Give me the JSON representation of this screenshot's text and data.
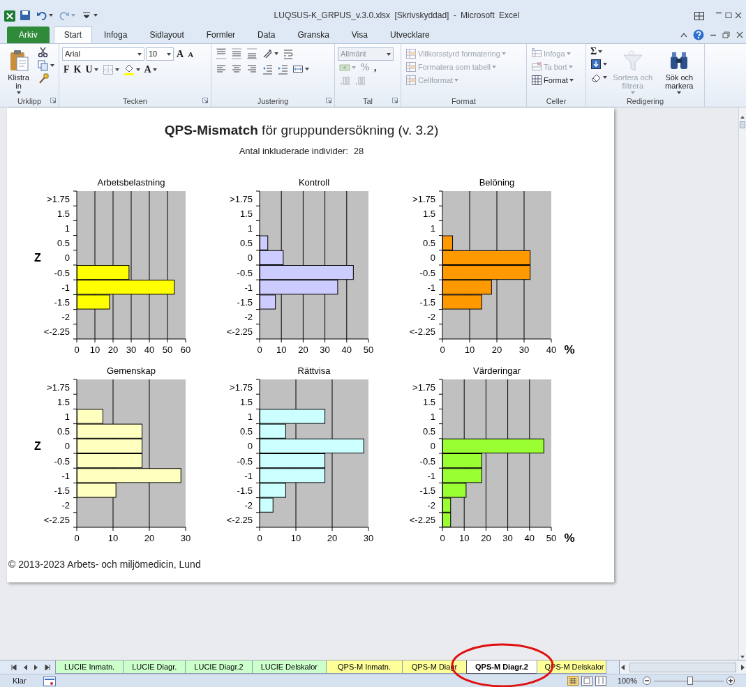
{
  "window": {
    "title": "LUQSUS-K_GRPUS_v.3.0.xlsx [Skrivskyddad] - Microsoft Excel"
  },
  "quick_access": [
    {
      "caret": false,
      "disabled": false
    },
    {
      "caret": true,
      "disabled": false
    },
    {
      "caret": true,
      "disabled": true
    },
    {
      "caret": true,
      "disabled": false
    }
  ],
  "ribbon_tabs": [
    {
      "label": "Arkiv",
      "kind": "file",
      "selected": false
    },
    {
      "label": "Start",
      "kind": "tab",
      "selected": true
    },
    {
      "label": "Infoga",
      "kind": "tab",
      "selected": false
    },
    {
      "label": "Sidlayout",
      "kind": "tab",
      "selected": false
    },
    {
      "label": "Formler",
      "kind": "tab",
      "selected": false
    },
    {
      "label": "Data",
      "kind": "tab",
      "selected": false
    },
    {
      "label": "Granska",
      "kind": "tab",
      "selected": false
    },
    {
      "label": "Visa",
      "kind": "tab",
      "selected": false
    },
    {
      "label": "Utvecklare",
      "kind": "tab",
      "selected": false
    }
  ],
  "ribbon_groups": [
    {
      "label": "Urklipp",
      "launcher": true,
      "columns": [
        [
          {
            "kind": "large",
            "label": "Klistra in",
            "caret": true,
            "disabled": false
          }
        ],
        [
          {
            "kind": "tool",
            "caret": false,
            "disabled": false
          },
          {
            "kind": "tool",
            "caret": true,
            "disabled": false
          },
          {
            "kind": "tool",
            "caret": false,
            "disabled": false
          }
        ]
      ]
    },
    {
      "label": "Tecken",
      "launcher": true,
      "lines": [
        [
          {
            "kind": "field",
            "value": "Arial",
            "disabled": false
          },
          {
            "kind": "field",
            "value": "10",
            "disabled": false
          },
          {
            "kind": "glyph",
            "label": "A",
            "caret": false,
            "disabled": false
          },
          {
            "kind": "glyph",
            "label": "A",
            "caret": false,
            "disabled": false
          }
        ],
        [
          {
            "kind": "glyph",
            "label": "F",
            "caret": false,
            "disabled": false
          },
          {
            "kind": "glyph",
            "label": "K",
            "caret": false,
            "disabled": false
          },
          {
            "kind": "glyph",
            "label": "U",
            "caret": true,
            "disabled": false
          },
          {
            "kind": "tool",
            "caret": true,
            "disabled": false
          },
          {
            "kind": "tool",
            "caret": true,
            "disabled": false
          },
          {
            "kind": "glyph",
            "label": "A",
            "caret": true,
            "disabled": false
          }
        ]
      ]
    },
    {
      "label": "Justering",
      "launcher": true,
      "lines": [
        [
          {
            "kind": "tool",
            "caret": false,
            "disabled": false
          },
          {
            "kind": "tool",
            "caret": false,
            "disabled": false
          },
          {
            "kind": "tool",
            "caret": false,
            "disabled": false
          },
          {
            "kind": "tool",
            "caret": true,
            "disabled": false
          },
          {
            "kind": "tool",
            "caret": false,
            "disabled": false
          }
        ],
        [
          {
            "kind": "tool",
            "caret": false,
            "disabled": false
          },
          {
            "kind": "tool",
            "caret": false,
            "disabled": false
          },
          {
            "kind": "tool",
            "caret": false,
            "disabled": false
          },
          {
            "kind": "tool",
            "caret": false,
            "disabled": false
          },
          {
            "kind": "tool",
            "caret": false,
            "disabled": false
          },
          {
            "kind": "tool",
            "caret": true,
            "disabled": false
          }
        ]
      ]
    },
    {
      "label": "Tal",
      "launcher": true,
      "lines": [
        [
          {
            "kind": "field",
            "value": "Allmänt",
            "disabled": true
          }
        ],
        [
          {
            "kind": "tool",
            "caret": true,
            "disabled": true
          },
          {
            "kind": "glyph",
            "label": "%",
            "caret": false,
            "disabled": true
          },
          {
            "kind": "glyph",
            "label": ",",
            "caret": false,
            "disabled": false
          }
        ],
        [
          {
            "kind": "tool",
            "caret": false,
            "disabled": true
          },
          {
            "kind": "tool",
            "caret": false,
            "disabled": true
          }
        ]
      ]
    },
    {
      "label": "Format",
      "launcher": false,
      "lines": [
        [
          {
            "kind": "small",
            "label": "Villkorsstyrd formatering",
            "caret": true,
            "disabled": true
          }
        ],
        [
          {
            "kind": "small",
            "label": "Formatera som tabell",
            "caret": true,
            "disabled": true
          }
        ],
        [
          {
            "kind": "small",
            "label": "Cellformat",
            "caret": true,
            "disabled": true
          }
        ]
      ]
    },
    {
      "label": "Celler",
      "launcher": false,
      "lines": [
        [
          {
            "kind": "small",
            "label": "Infoga",
            "caret": true,
            "disabled": true
          }
        ],
        [
          {
            "kind": "small",
            "label": "Ta bort",
            "caret": true,
            "disabled": true
          }
        ],
        [
          {
            "kind": "small",
            "label": "Format",
            "caret": true,
            "disabled": false
          }
        ]
      ]
    },
    {
      "label": "Redigering",
      "launcher": false,
      "columns": [
        [
          {
            "kind": "glyph",
            "label": "Σ",
            "caret": true,
            "disabled": false
          },
          {
            "kind": "tool",
            "caret": true,
            "disabled": false
          },
          {
            "kind": "tool",
            "caret": true,
            "disabled": false
          }
        ],
        [
          {
            "kind": "large",
            "label": "Sortera och filtrera",
            "caret": true,
            "disabled": true
          }
        ],
        [
          {
            "kind": "large",
            "label": "Sök och markera",
            "caret": true,
            "disabled": false
          }
        ]
      ]
    }
  ],
  "report": {
    "title": "**QPS-Mismatch** för gruppundersökning (v. 3.2)",
    "subtitle": "Antal inkluderade individer:",
    "count": "28",
    "footer": "© 2013-2023 Arbets- och miljömedicin, Lund"
  },
  "charts": [
    {
      "chart_data": {
        "type": "bar",
        "orientation": "horizontal",
        "grid": true,
        "title": "Arbetsbelastning",
        "ylabel": "Z",
        "categories": [
          ">1.75",
          "1.5",
          "1",
          "0.5",
          "0",
          "-0.5",
          "-1",
          "-1.5",
          "-2",
          "<-2.25"
        ],
        "series": [
          {
            "color": "#ffff00",
            "values": [
              null,
              null,
              null,
              null,
              null,
              28.6,
              53.6,
              17.9,
              null,
              null
            ]
          }
        ],
        "xlim": [
          0,
          60
        ],
        "xticks": [
          0,
          10,
          20,
          30,
          40,
          50,
          60
        ]
      }
    },
    {
      "chart_data": {
        "type": "bar",
        "orientation": "horizontal",
        "grid": true,
        "title": "Kontroll",
        "categories": [
          ">1.75",
          "1.5",
          "1",
          "0.5",
          "0",
          "-0.5",
          "-1",
          "-1.5",
          "-2",
          "<-2.25"
        ],
        "series": [
          {
            "color": "#ccccff",
            "values": [
              null,
              null,
              null,
              3.6,
              10.7,
              42.9,
              35.7,
              7.1,
              null,
              null
            ]
          }
        ],
        "xlim": [
          0,
          50
        ],
        "xticks": [
          0,
          10,
          20,
          30,
          40,
          50
        ]
      }
    },
    {
      "chart_data": {
        "type": "bar",
        "orientation": "horizontal",
        "grid": true,
        "title": "Belöning",
        "xlabel": "%",
        "categories": [
          ">1.75",
          "1.5",
          "1",
          "0.5",
          "0",
          "-0.5",
          "-1",
          "-1.5",
          "-2",
          "<-2.25"
        ],
        "series": [
          {
            "color": "#ff9900",
            "values": [
              null,
              null,
              null,
              3.6,
              32.1,
              32.1,
              17.9,
              14.3,
              null,
              null
            ]
          }
        ],
        "xlim": [
          0,
          40
        ],
        "xticks": [
          0,
          10,
          20,
          30,
          40
        ]
      }
    },
    {
      "chart_data": {
        "type": "bar",
        "orientation": "horizontal",
        "grid": true,
        "title": "Gemenskap",
        "ylabel": "Z",
        "categories": [
          ">1.75",
          "1.5",
          "1",
          "0.5",
          "0",
          "-0.5",
          "-1",
          "-1.5",
          "-2",
          "<-2.25"
        ],
        "series": [
          {
            "color": "#ffffc0",
            "values": [
              null,
              null,
              7.1,
              17.9,
              17.9,
              17.9,
              28.6,
              10.7,
              null,
              null
            ]
          }
        ],
        "xlim": [
          0,
          30
        ],
        "xticks": [
          0,
          10,
          20,
          30
        ]
      }
    },
    {
      "chart_data": {
        "type": "bar",
        "orientation": "horizontal",
        "grid": true,
        "title": "Rättvisa",
        "categories": [
          ">1.75",
          "1.5",
          "1",
          "0.5",
          "0",
          "-0.5",
          "-1",
          "-1.5",
          "-2",
          "<-2.25"
        ],
        "series": [
          {
            "color": "#ccffff",
            "values": [
              null,
              null,
              17.9,
              7.1,
              28.6,
              17.9,
              17.9,
              7.1,
              3.6,
              null
            ]
          }
        ],
        "xlim": [
          0,
          30
        ],
        "xticks": [
          0,
          10,
          20,
          30
        ]
      }
    },
    {
      "chart_data": {
        "type": "bar",
        "orientation": "horizontal",
        "grid": true,
        "title": "Värderingar",
        "xlabel": "%",
        "categories": [
          ">1.75",
          "1.5",
          "1",
          "0.5",
          "0",
          "-0.5",
          "-1",
          "-1.5",
          "-2",
          "<-2.25"
        ],
        "series": [
          {
            "color": "#99ff33",
            "values": [
              null,
              null,
              null,
              null,
              46.4,
              17.9,
              17.9,
              10.7,
              3.6,
              3.6
            ]
          }
        ],
        "xlim": [
          0,
          50
        ],
        "xticks": [
          0,
          10,
          20,
          30,
          40,
          50
        ]
      }
    }
  ],
  "sheet_tabs": [
    {
      "label": "LUCIE Inmatn.",
      "color": "#ccffcc",
      "selected": false
    },
    {
      "label": "LUCIE Diagr.",
      "color": "#ccffcc",
      "selected": false
    },
    {
      "label": "LUCIE Diagr.2",
      "color": "#ccffcc",
      "selected": false
    },
    {
      "label": "LUCIE Delskalor",
      "color": "#ccffcc",
      "selected": false
    },
    {
      "label": "QPS-M Inmatn.",
      "color": "#ffff99",
      "selected": false
    },
    {
      "label": "QPS-M Diagr",
      "color": "#ffff99",
      "selected": false
    },
    {
      "label": "QPS-M Diagr.2",
      "color": "#ffffff",
      "selected": true
    },
    {
      "label": "QPS-M Delskalor",
      "color": "#ffff99",
      "selected": false
    }
  ],
  "status_bar": {
    "status": "Klar",
    "zoom": "100%",
    "zoom_slider": {
      "level": 0.52
    }
  },
  "annotation": {
    "kind": "ellipse"
  }
}
